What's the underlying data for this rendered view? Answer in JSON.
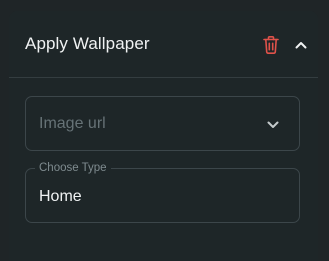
{
  "panel": {
    "title": "Apply Wallpaper",
    "delete_icon": "trash-icon",
    "collapse_icon": "chevron-up-icon"
  },
  "image_field": {
    "placeholder": "Image url",
    "dropdown_icon": "chevron-down-icon"
  },
  "type_field": {
    "label": "Choose Type",
    "value": "Home"
  },
  "colors": {
    "background": "#1e2628",
    "text": "#f0f2f3",
    "danger": "#e0524a",
    "border": "#3c464a",
    "placeholder": "#667276"
  }
}
